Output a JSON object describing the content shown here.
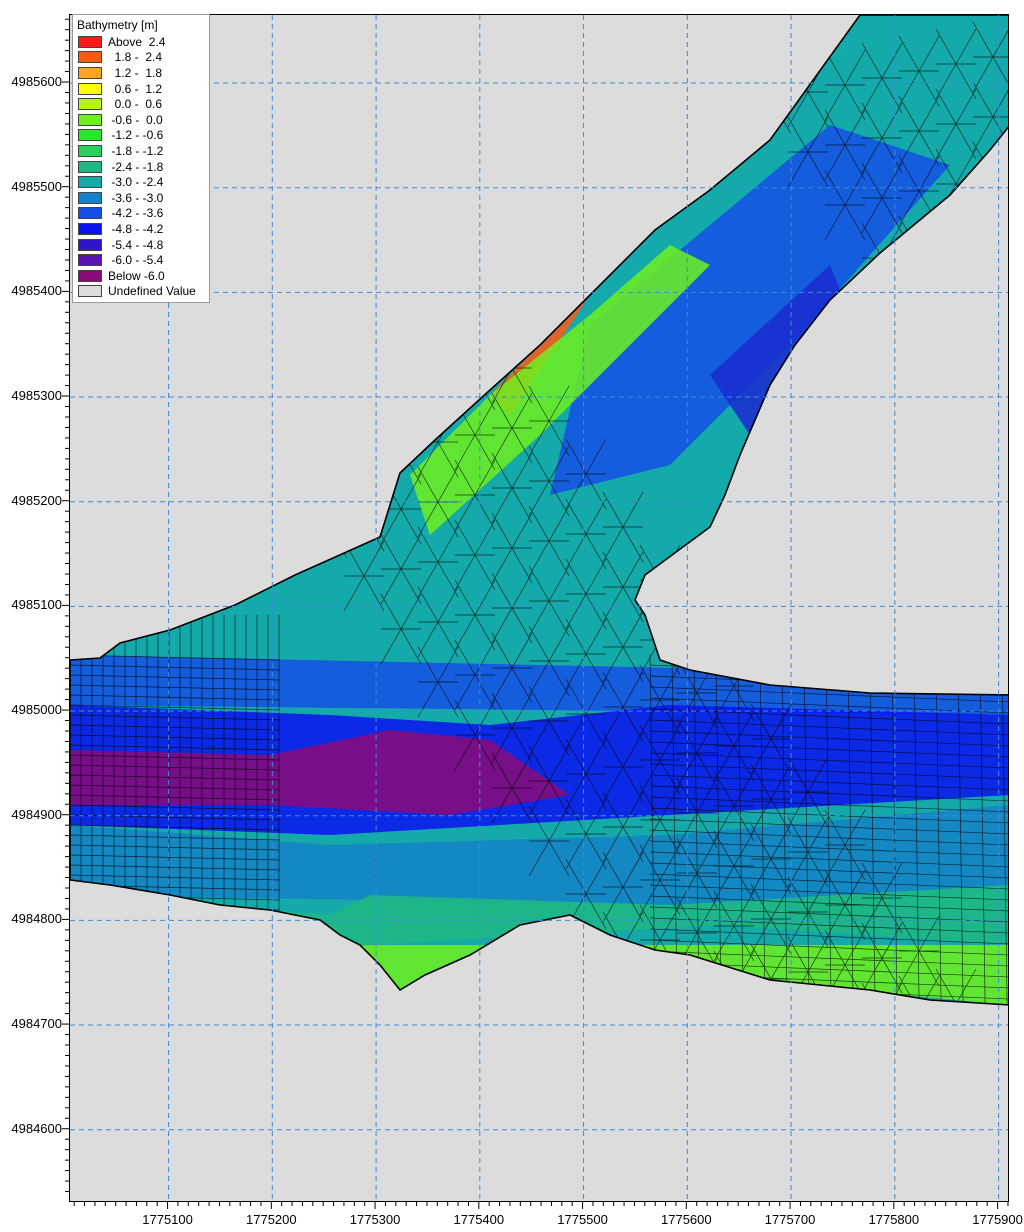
{
  "legend": {
    "title": "Bathymetry [m]",
    "items": [
      {
        "label": "Above  2.4",
        "color": "#ff1a1a"
      },
      {
        "label": "  1.8 -  2.4",
        "color": "#ff5a14"
      },
      {
        "label": "  1.2 -  1.8",
        "color": "#ffa41e"
      },
      {
        "label": "  0.6 -  1.2",
        "color": "#ffff00"
      },
      {
        "label": "  0.0 -  0.6",
        "color": "#b4f514"
      },
      {
        "label": " -0.6 -  0.0",
        "color": "#6ef01e"
      },
      {
        "label": " -1.2 - -0.6",
        "color": "#28e628"
      },
      {
        "label": " -1.8 - -1.2",
        "color": "#28d25a"
      },
      {
        "label": " -2.4 - -1.8",
        "color": "#1eb982"
      },
      {
        "label": " -3.0 - -2.4",
        "color": "#14aaaa"
      },
      {
        "label": " -3.6 - -3.0",
        "color": "#1482c8"
      },
      {
        "label": " -4.2 - -3.6",
        "color": "#1450e6"
      },
      {
        "label": " -4.8 - -4.2",
        "color": "#0a14f0"
      },
      {
        "label": " -5.4 - -4.8",
        "color": "#3214c8"
      },
      {
        "label": " -6.0 - -5.4",
        "color": "#5a14b4"
      },
      {
        "label": "Below -6.0",
        "color": "#8c0a78"
      },
      {
        "label": "Undefined Value",
        "color": "#dcdcdc"
      }
    ]
  },
  "axes": {
    "x_ticks": [
      "1775100",
      "1775200",
      "1775300",
      "1775400",
      "1775500",
      "1775600",
      "1775700",
      "1775800",
      "1775900"
    ],
    "y_ticks": [
      "4985600",
      "4985500",
      "4985400",
      "4985300",
      "4985200",
      "4985100",
      "4985000",
      "4984900",
      "4984800",
      "4984700",
      "4984600"
    ],
    "x_range": [
      1775005,
      1775911
    ],
    "y_range": [
      4984530,
      4985665
    ],
    "grid": true,
    "grid_color": "#3c8cdc"
  },
  "mesh": {
    "domain_color": "#14aaaa",
    "line_color": "#000000"
  }
}
